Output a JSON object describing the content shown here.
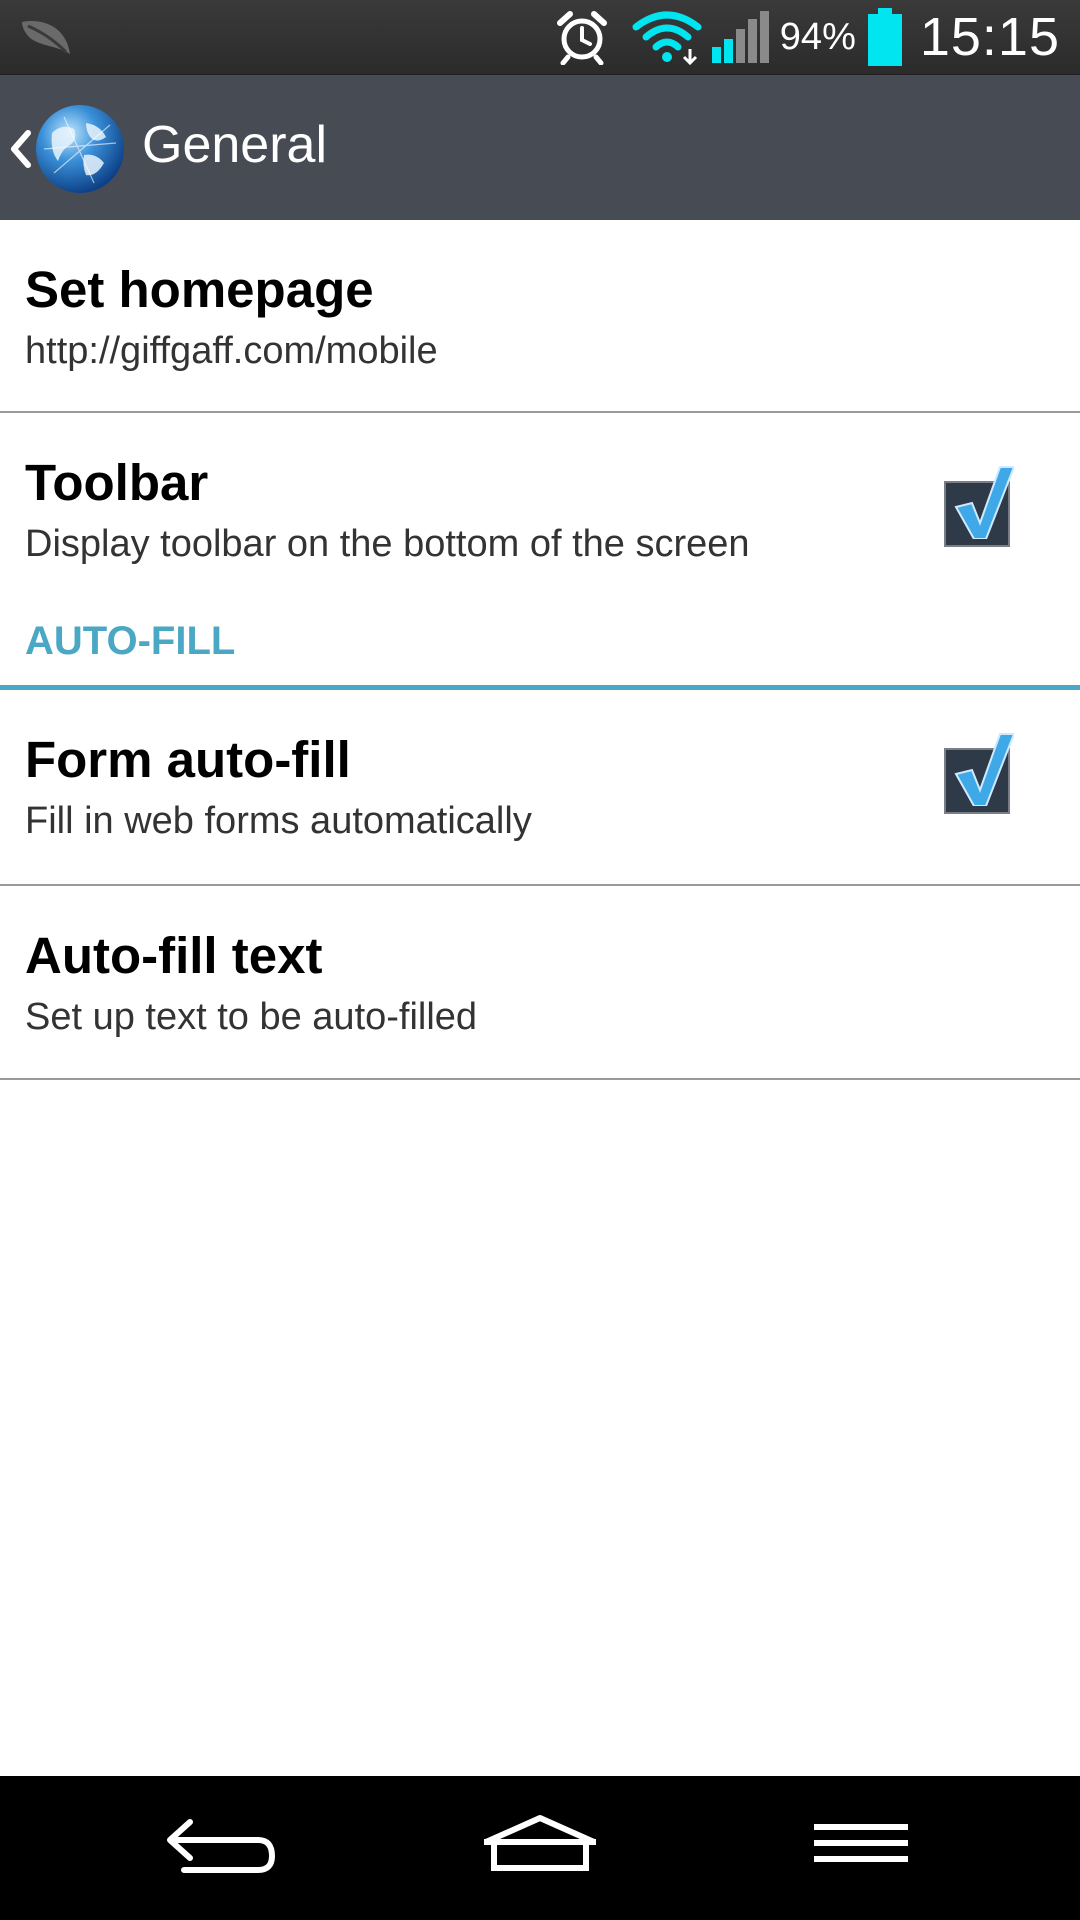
{
  "status_bar": {
    "battery_percent": "94%",
    "time": "15:15",
    "icons": [
      "leaf-icon",
      "alarm-icon",
      "wifi-icon",
      "signal-icon",
      "battery-icon"
    ],
    "accent_color": "#00e5f0"
  },
  "action_bar": {
    "title": "General",
    "app_icon": "globe-icon"
  },
  "settings": {
    "homepage": {
      "title": "Set homepage",
      "value": "http://giffgaff.com/mobile"
    },
    "toolbar": {
      "title": "Toolbar",
      "summary": "Display toolbar on the bottom of the screen",
      "checked": true
    },
    "autofill_section": {
      "header": "AUTO-FILL"
    },
    "form_autofill": {
      "title": "Form auto-fill",
      "summary": "Fill in web forms automatically",
      "checked": true
    },
    "autofill_text": {
      "title": "Auto-fill text",
      "summary": "Set up text to be auto-filled"
    }
  },
  "nav_bar": {
    "buttons": [
      "back-icon",
      "home-icon",
      "menu-icon"
    ]
  },
  "colors": {
    "section_accent": "#4aa8c4",
    "action_bar": "#474b53",
    "checkmark": "#3fa9e8"
  }
}
